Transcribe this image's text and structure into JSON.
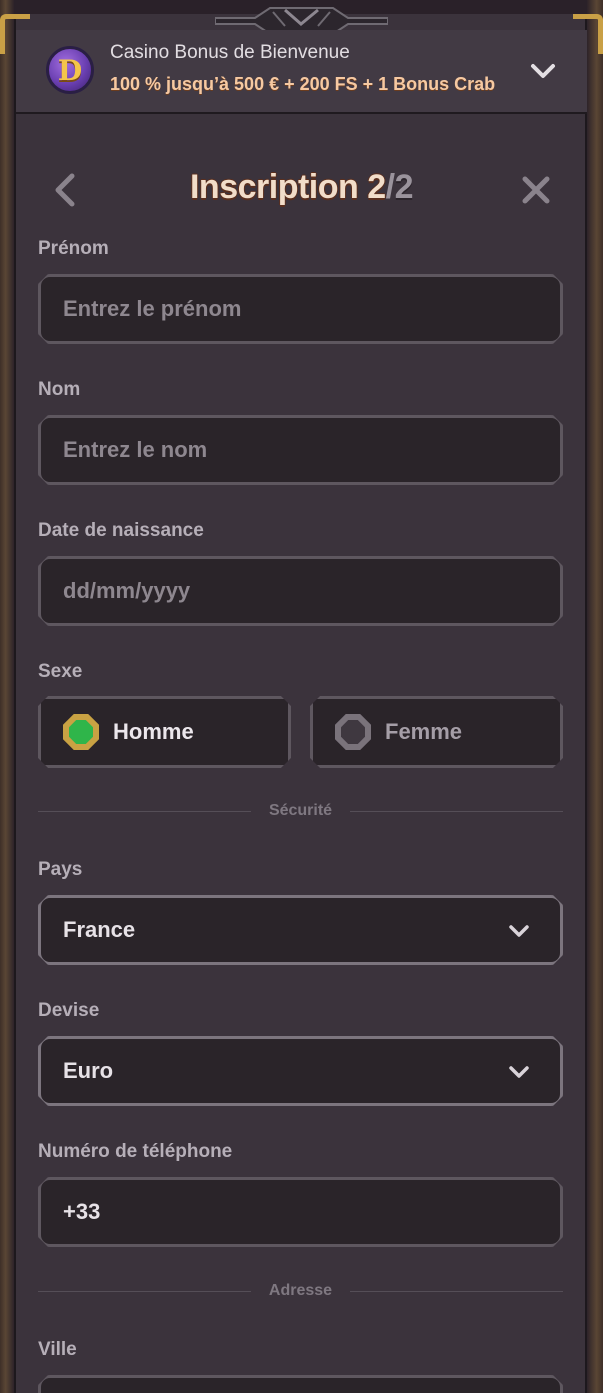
{
  "bonus": {
    "title": "Casino Bonus de Bienvenue",
    "subtitle": "100 % jusqu’à 500 € + 200 FS + 1 Bonus Crab",
    "logo_letter": "D"
  },
  "header": {
    "title_main": "Inscription 2",
    "title_slash": "/",
    "title_total": "2"
  },
  "form": {
    "first_name": {
      "label": "Prénom",
      "placeholder": "Entrez le prénom"
    },
    "last_name": {
      "label": "Nom",
      "placeholder": "Entrez le nom"
    },
    "birth_date": {
      "label": "Date de naissance",
      "placeholder": "dd/mm/yyyy"
    },
    "gender": {
      "label": "Sexe",
      "options": [
        "Homme",
        "Femme"
      ],
      "selected": "Homme"
    },
    "security_divider": "Sécurité",
    "country": {
      "label": "Pays",
      "value": "France"
    },
    "currency": {
      "label": "Devise",
      "value": "Euro"
    },
    "phone": {
      "label": "Numéro de téléphone",
      "value": "+33"
    },
    "address_divider": "Adresse",
    "city": {
      "label": "Ville"
    }
  },
  "colors": {
    "accent_gold": "#c9a046",
    "selected_green": "#2fb54a",
    "panel_bg": "#3b333c",
    "field_bg": "#2a2429"
  },
  "icons": {
    "bonus_logo": "casino-chip-icon",
    "bonus_toggle": "chevron-down-icon",
    "back": "chevron-left-icon",
    "close": "close-icon",
    "select_arrow": "chevron-down-icon"
  }
}
